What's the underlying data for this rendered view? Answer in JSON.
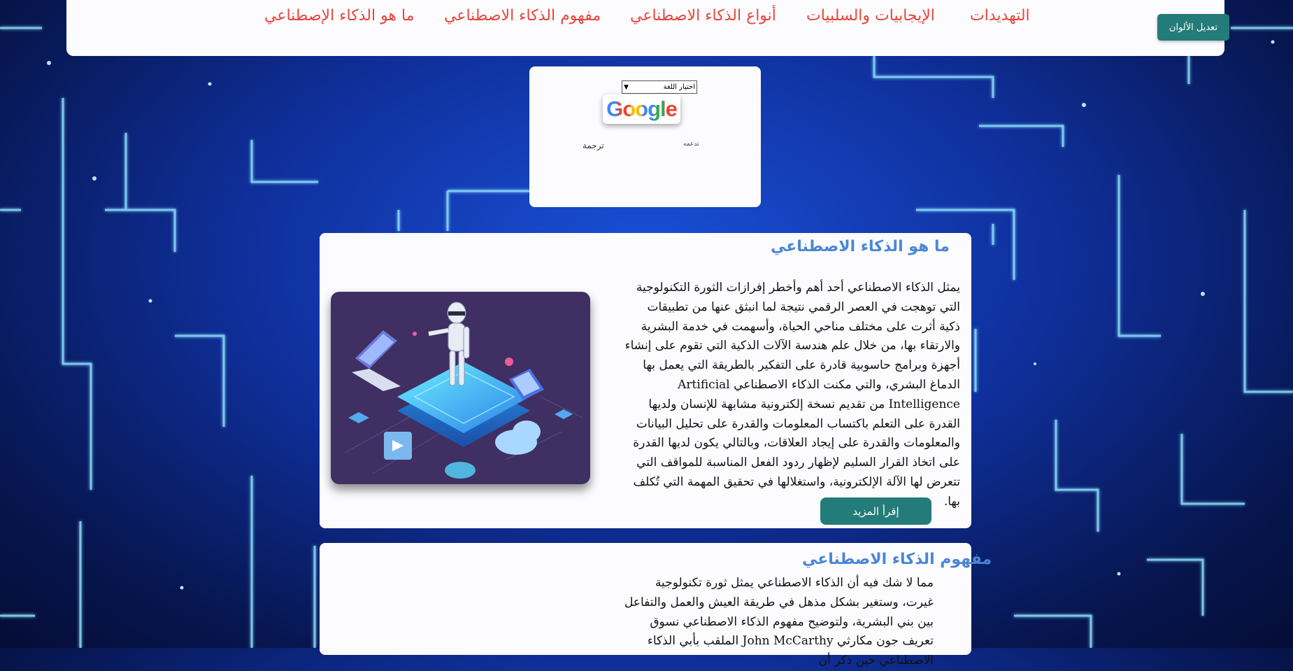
{
  "nav": {
    "links": [
      "ما هو الذكاء الإصطناعي",
      "مفهوم الذكاء الاصطناعي",
      "أنواع الذكاء الاصطناعي",
      "الإيجابيات والسلبيات",
      "التهديدات"
    ],
    "colors_button": "تعديل الألوان"
  },
  "translate": {
    "select_label": "اختيار اللغة",
    "google_logo": "Google",
    "powered_by": "تدعمه",
    "translate_label": "ترجمة"
  },
  "section1": {
    "title": "ما هو الذكاء الاصطناعي",
    "text": "يمثل الذكاء الاصطناعي أحد أهم وأخطر إفرازات الثورة التكنولوجية التي توهجت في العصر الرقمي نتيجة لما انبثق عنها من تطبيقات ذكية أثرت على مختلف مناحي الحياة، وأسهمت في خدمة البشرية والارتقاء بها، من خلال علم هندسة الآلات الذكية التي تقوم على إنشاء أجهزة وبرامج حاسوبية قادرة على التفكير بالطريقة التي يعمل بها الدماغ البشري، والتي مكنت الذكاء الاصطناعي Artificial Intelligence من تقديم نسخة إلكترونية مشابهة للإنسان ولديها القدرة على التعلم باكتساب المعلومات والقدرة على تحليل البيانات والمعلومات والقدرة على إيجاد العلاقات، وبالتالي يكون لديها القدرة على اتخاذ القرار السليم لإظهار ردود الفعل المناسبة للمواقف التي تتعرض لها الآلة الإلكترونية، واستغلالها في تحقيق المهمة التي تُكلف بها.",
    "read_more": "إقرأ المزيد"
  },
  "section2": {
    "title": "مفهوم الذكاء الاصطناعي",
    "text": "مما لا شك فيه أن الذكاء الاصطناعي يمثل ثورة تكنولوجية غيرت، وستغير بشكل مذهل في طريقة العيش والعمل والتفاعل بين بني البشرية، ولتوضيح مفهوم الذكاء الاصطناعي نسوق تعريف جون مكارثي John McCarthy الملقب بأبي الذكاء الاصطناعي حين ذكر أن"
  },
  "colors": {
    "nav_link": "#e8443a",
    "title": "#4a86d6",
    "button": "#237c79"
  }
}
